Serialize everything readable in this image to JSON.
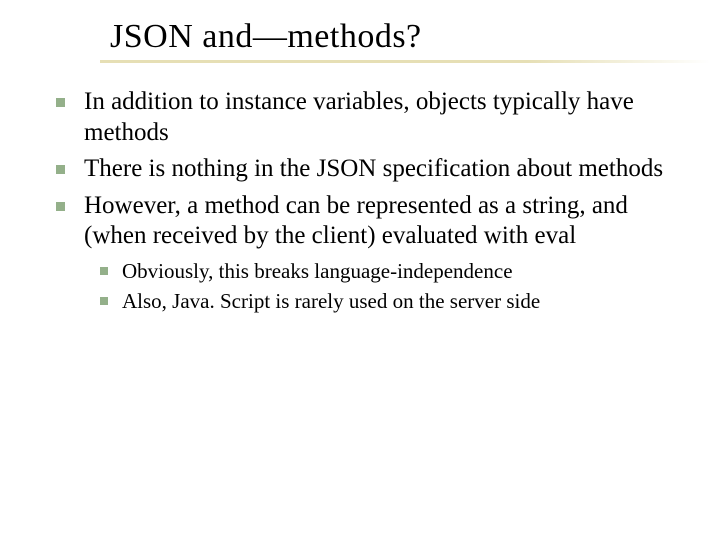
{
  "slide": {
    "title": "JSON and—methods?",
    "bullets": [
      {
        "text": "In addition to instance variables, objects typically have methods"
      },
      {
        "text": "There is nothing in the JSON specification about methods"
      },
      {
        "text": "However, a method can be represented as a string, and (when received by the client) evaluated with eval"
      }
    ],
    "subbullets": [
      {
        "text": "Obviously, this breaks language-independence"
      },
      {
        "text": "Also, Java. Script is rarely used on the server side"
      }
    ]
  }
}
